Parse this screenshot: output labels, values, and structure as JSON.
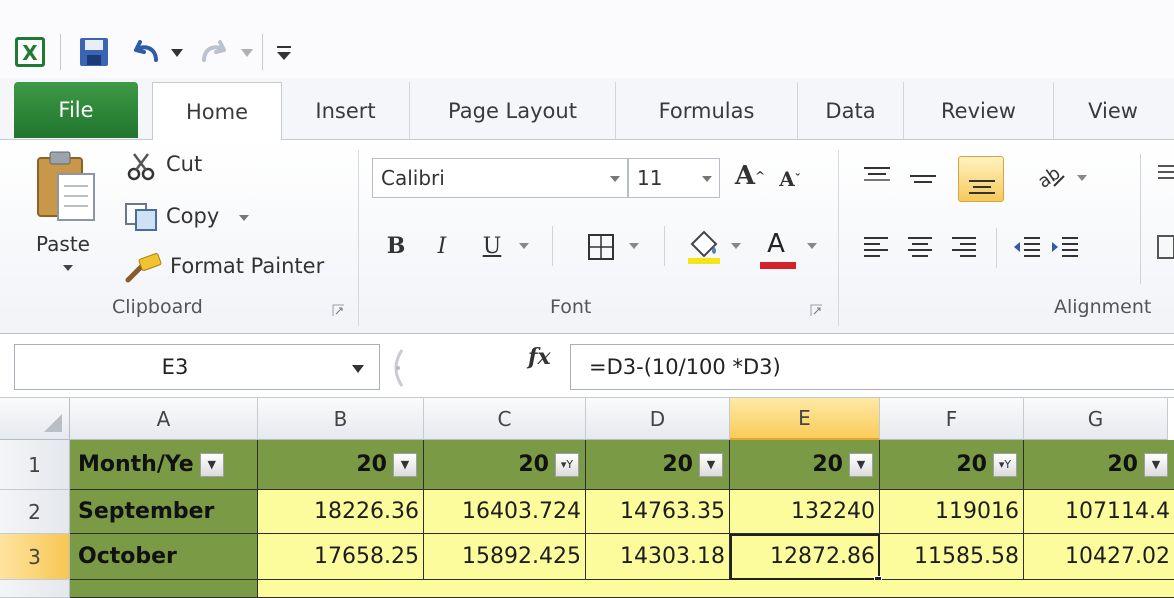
{
  "tabs": [
    {
      "label": "File"
    },
    {
      "label": "Home"
    },
    {
      "label": "Insert"
    },
    {
      "label": "Page Layout"
    },
    {
      "label": "Formulas"
    },
    {
      "label": "Data"
    },
    {
      "label": "Review"
    },
    {
      "label": "View"
    }
  ],
  "clipboard": {
    "paste": "Paste",
    "cut": "Cut",
    "copy": "Copy",
    "format_painter": "Format Painter",
    "group_label": "Clipboard"
  },
  "font": {
    "name": "Calibri",
    "size": "11",
    "bold": "B",
    "italic": "I",
    "underline": "U",
    "grow": "A",
    "shrink": "A",
    "color": "A",
    "group_label": "Font"
  },
  "alignment": {
    "group_label": "Alignment"
  },
  "formula_bar": {
    "name_box": "E3",
    "fx": "fx",
    "formula": "=D3-(10/100 *D3)"
  },
  "grid": {
    "columns": [
      "A",
      "B",
      "C",
      "D",
      "E",
      "F",
      "G"
    ],
    "rows": [
      "1",
      "2",
      "3"
    ],
    "header_row": [
      "Month/Ye",
      "20",
      "20",
      "20",
      "20",
      "20",
      "20"
    ],
    "data": [
      [
        "September",
        "18226.36",
        "16403.724",
        "14763.35",
        "132240",
        "119016",
        "107114.4"
      ],
      [
        "October",
        "17658.25",
        "15892.425",
        "14303.18",
        "12872.86",
        "11585.58",
        "10427.02"
      ]
    ]
  },
  "colors": {
    "header_fill": "#7a9a45",
    "data_fill": "#fdfc9c",
    "selection": "#f9cc5a",
    "file_tab": "#2f8a3a"
  }
}
